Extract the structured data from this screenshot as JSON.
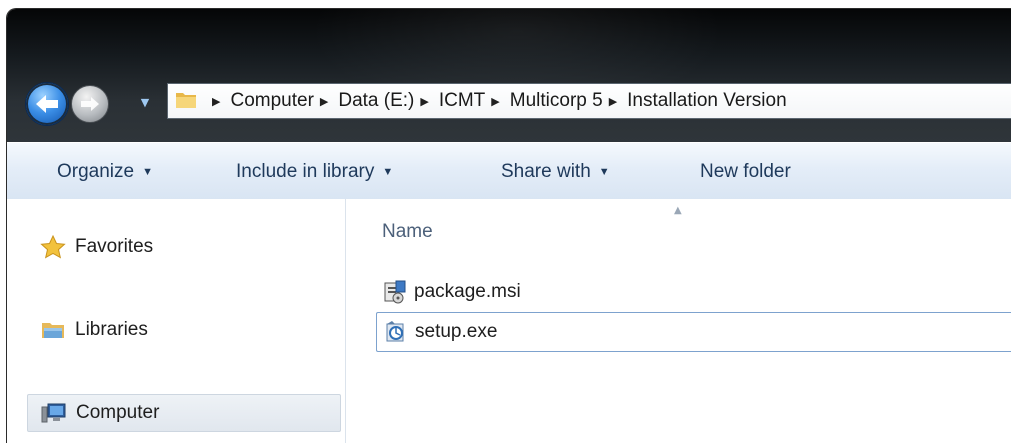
{
  "address_bar": {
    "path": [
      {
        "label": "Computer"
      },
      {
        "label": "Data (E:)"
      },
      {
        "label": "ICMT"
      },
      {
        "label": "Multicorp 5"
      },
      {
        "label": "Installation Version"
      }
    ],
    "icons": {
      "back": "back-arrow-icon",
      "forward": "forward-arrow-icon",
      "history": "chevron-down-icon",
      "folder": "folder-icon"
    }
  },
  "toolbar": {
    "organize": "Organize",
    "include_in_library": "Include in library",
    "share_with": "Share with",
    "new_folder": "New folder"
  },
  "nav_pane": {
    "items": [
      {
        "label": "Favorites",
        "icon": "star-icon"
      },
      {
        "label": "Libraries",
        "icon": "libraries-icon"
      },
      {
        "label": "Computer",
        "icon": "computer-icon",
        "selected": true
      }
    ]
  },
  "file_list": {
    "column_name": "Name",
    "files": [
      {
        "name": "package.msi",
        "icon": "msi-installer-icon"
      },
      {
        "name": "setup.exe",
        "icon": "setup-exe-icon",
        "focused": true
      }
    ]
  },
  "colors": {
    "accent": "#1e395b",
    "selection_border": "#7da2ce"
  }
}
